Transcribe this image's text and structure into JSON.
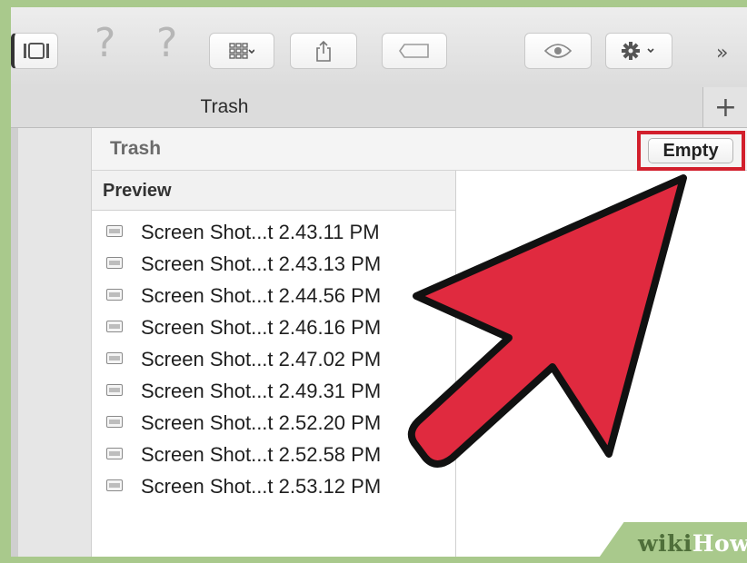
{
  "toolbar": {
    "buttons": [
      {
        "name": "sidebar-toggle-button",
        "icon": "sidebar-icon"
      },
      {
        "name": "help-button-1",
        "icon": "question-icon"
      },
      {
        "name": "help-button-2",
        "icon": "question-icon"
      },
      {
        "name": "view-options-button",
        "icon": "grid-icon"
      },
      {
        "name": "share-button",
        "icon": "share-icon"
      },
      {
        "name": "tag-button",
        "icon": "tag-icon"
      },
      {
        "name": "quick-look-button",
        "icon": "eye-icon"
      },
      {
        "name": "action-menu-button",
        "icon": "gear-icon"
      }
    ],
    "overflow_label": "»"
  },
  "tabbar": {
    "tab_label": "Trash",
    "add_label": "+"
  },
  "header": {
    "title": "Trash",
    "empty_button": "Empty"
  },
  "list": {
    "column_header": "Preview",
    "items": [
      "Screen Shot...t 2.43.11 PM",
      "Screen Shot...t 2.43.13 PM",
      "Screen Shot...t 2.44.56 PM",
      "Screen Shot...t 2.46.16 PM",
      "Screen Shot...t 2.47.02 PM",
      "Screen Shot...t 2.49.31 PM",
      "Screen Shot...t 2.52.20 PM",
      "Screen Shot...t 2.52.58 PM",
      "Screen Shot...t 2.53.12 PM"
    ]
  },
  "annotation": {
    "arrow_color": "#e02a3f",
    "highlight_color": "#d21f2c"
  },
  "watermark": {
    "wiki": "wiki",
    "how": "How"
  }
}
